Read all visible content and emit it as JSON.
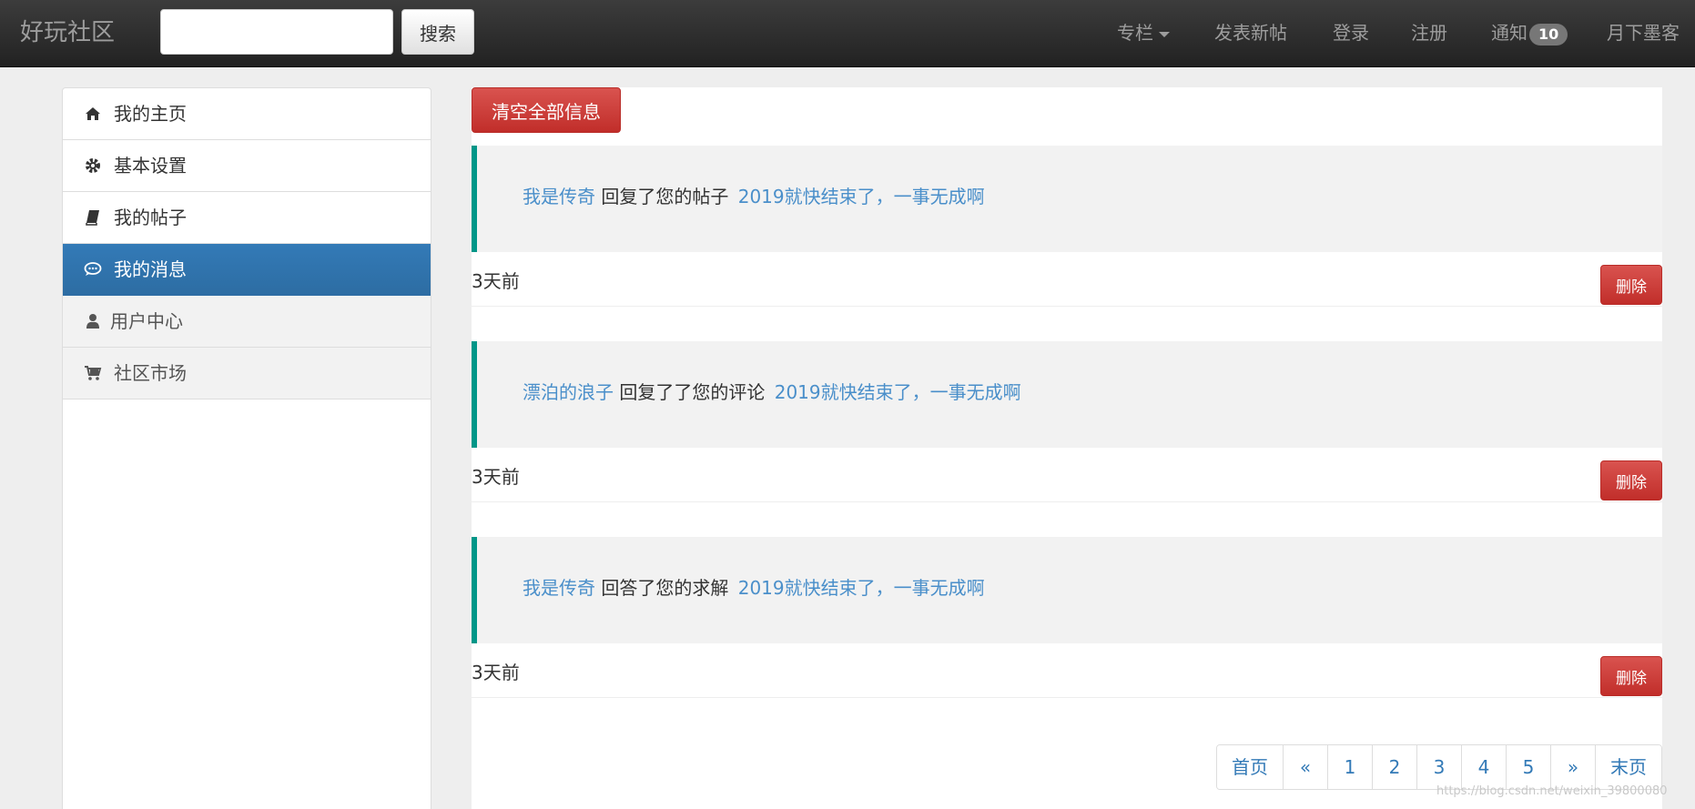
{
  "navbar": {
    "brand": "好玩社区",
    "search_placeholder": "",
    "search_button": "搜索",
    "items": {
      "column": "专栏",
      "new_post": "发表新帖",
      "login": "登录",
      "register": "注册",
      "notice": "通知",
      "notice_count": "10",
      "user": "月下墨客"
    }
  },
  "sidebar": {
    "items": [
      {
        "label": "我的主页",
        "icon": "home-icon"
      },
      {
        "label": "基本设置",
        "icon": "gear-icon"
      },
      {
        "label": "我的帖子",
        "icon": "book-icon"
      },
      {
        "label": "我的消息",
        "icon": "chat-icon",
        "active": true
      },
      {
        "label": "用户中心",
        "icon": "user-icon"
      },
      {
        "label": "社区市场",
        "icon": "cart-icon"
      }
    ]
  },
  "main": {
    "clear_all": "清空全部信息",
    "messages": [
      {
        "user": "我是传奇",
        "action": "回复了您的帖子",
        "topic": "2019就快结束了，一事无成啊",
        "time": "3天前",
        "delete": "删除"
      },
      {
        "user": "漂泊的浪子",
        "action": "回复了了您的评论",
        "topic": "2019就快结束了，一事无成啊",
        "time": "3天前",
        "delete": "删除"
      },
      {
        "user": "我是传奇",
        "action": "回答了您的求解",
        "topic": "2019就快结束了，一事无成啊",
        "time": "3天前",
        "delete": "删除"
      }
    ],
    "pagination": [
      "首页",
      "«",
      "1",
      "2",
      "3",
      "4",
      "5",
      "»",
      "末页"
    ]
  },
  "watermark": "https://blog.csdn.net/weixin_39800080",
  "colors": {
    "accent": "#337ab7",
    "danger": "#d9534f",
    "quote_border": "#009688",
    "link": "#4a8fca"
  }
}
